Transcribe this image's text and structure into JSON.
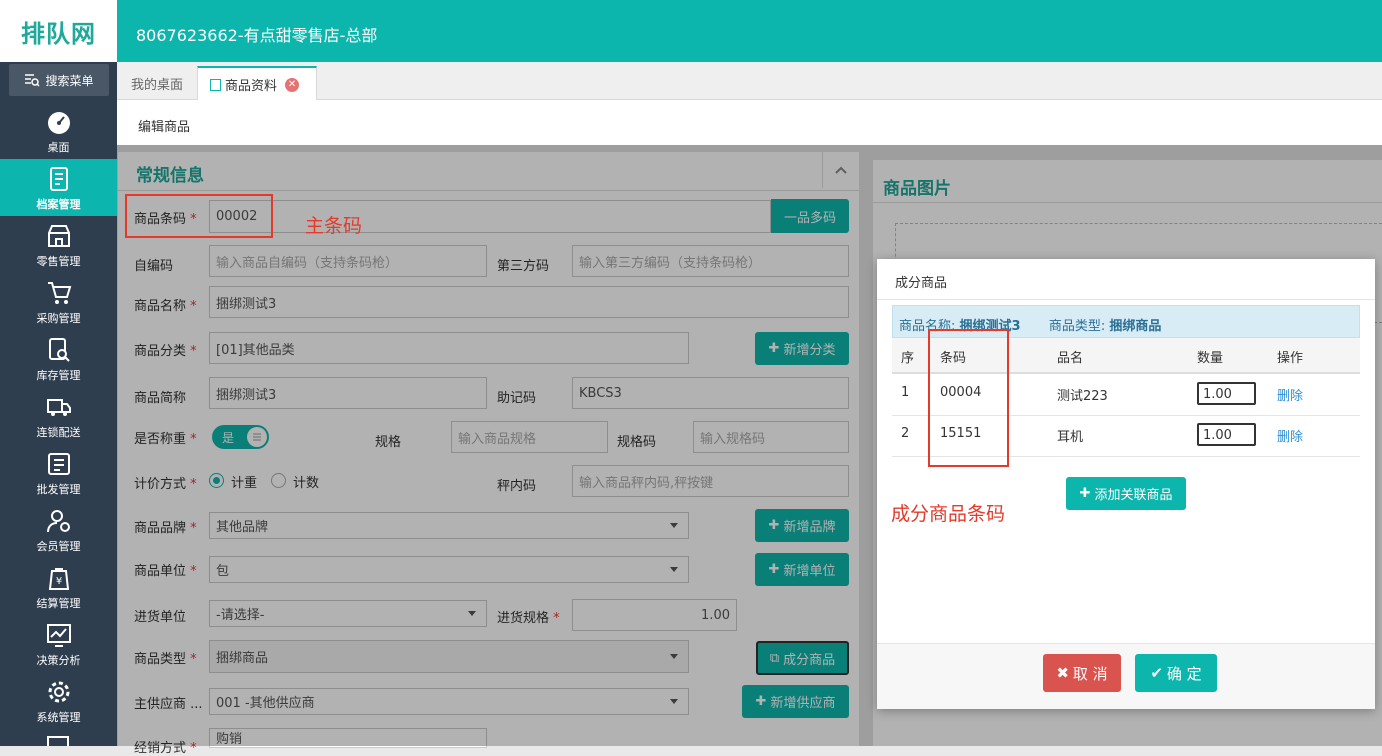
{
  "app": {
    "logo_text": "排队网",
    "store_title": "8067623662-有点甜零售店-总部"
  },
  "sidebar": {
    "search_label": "搜索菜单",
    "items": [
      {
        "label": "桌面",
        "icon": "dashboard-icon"
      },
      {
        "label": "档案管理",
        "icon": "file-icon",
        "active": true
      },
      {
        "label": "零售管理",
        "icon": "store-icon"
      },
      {
        "label": "采购管理",
        "icon": "cart-icon"
      },
      {
        "label": "库存管理",
        "icon": "inventory-icon"
      },
      {
        "label": "连锁配送",
        "icon": "truck-icon"
      },
      {
        "label": "批发管理",
        "icon": "wholesale-icon"
      },
      {
        "label": "会员管理",
        "icon": "member-icon"
      },
      {
        "label": "结算管理",
        "icon": "settlement-icon"
      },
      {
        "label": "决策分析",
        "icon": "chart-icon"
      },
      {
        "label": "系统管理",
        "icon": "gear-icon"
      }
    ]
  },
  "tabs": [
    {
      "label": "我的桌面"
    },
    {
      "label": "商品资料",
      "active": true
    }
  ],
  "subheader": {
    "title": "编辑商品"
  },
  "form": {
    "section_title": "常规信息",
    "barcode": {
      "label": "商品条码",
      "value": "00002"
    },
    "multi_code_button": "一品多码",
    "self_code": {
      "label": "自编码",
      "placeholder": "输入商品自编码（支持条码枪）"
    },
    "third_code": {
      "label": "第三方码",
      "placeholder": "输入第三方编码（支持条码枪）"
    },
    "name": {
      "label": "商品名称",
      "value": "捆绑测试3"
    },
    "category": {
      "label": "商品分类",
      "value": "[01]其他品类"
    },
    "add_category_button": "新增分类",
    "short_name": {
      "label": "商品简称",
      "value": "捆绑测试3"
    },
    "mnemonic": {
      "label": "助记码",
      "value": "KBCS3"
    },
    "weigh": {
      "label": "是否称重",
      "toggle_text": "是",
      "on": true
    },
    "spec": {
      "label": "规格",
      "placeholder": "输入商品规格"
    },
    "spec_code": {
      "label": "规格码",
      "placeholder": "输入规格码"
    },
    "pricing": {
      "label": "计价方式",
      "options": [
        "计重",
        "计数"
      ],
      "selected": "计重"
    },
    "scale_code": {
      "label": "秤内码",
      "placeholder": "输入商品秤内码,秤按键"
    },
    "brand": {
      "label": "商品品牌",
      "value": "其他品牌"
    },
    "add_brand_button": "新增品牌",
    "unit": {
      "label": "商品单位",
      "value": "包"
    },
    "add_unit_button": "新增单位",
    "purchase_unit": {
      "label": "进货单位",
      "value": "-请选择-"
    },
    "purchase_spec": {
      "label": "进货规格",
      "value": "1.00"
    },
    "type": {
      "label": "商品类型",
      "value": "捆绑商品"
    },
    "component_button": "成分商品",
    "supplier": {
      "label": "主供应商 ...",
      "value": "001 -其他供应商"
    },
    "add_supplier_button": "新增供应商",
    "sales_mode": {
      "label": "经销方式",
      "value": "购销"
    }
  },
  "image_panel": {
    "title": "商品图片"
  },
  "annotations": {
    "main_barcode": "主条码",
    "component_barcode": "成分商品条码"
  },
  "modal": {
    "title": "成分商品",
    "info": {
      "name_label": "商品名称:",
      "name_value": "捆绑测试3",
      "type_label": "商品类型:",
      "type_value": "捆绑商品"
    },
    "columns": [
      "序",
      "条码",
      "品名",
      "数量",
      "操作"
    ],
    "rows": [
      {
        "seq": "1",
        "barcode": "00004",
        "name": "测试223",
        "qty": "1.00",
        "action": "删除"
      },
      {
        "seq": "2",
        "barcode": "15151",
        "name": "耳机",
        "qty": "1.00",
        "action": "删除"
      }
    ],
    "add_button": "添加关联商品",
    "cancel_button": "取 消",
    "confirm_button": "确 定"
  },
  "colors": {
    "primary": "#0db6ad",
    "sidebar": "#2f3e4e",
    "danger": "#d9534f",
    "annotation": "#e53a2a"
  }
}
